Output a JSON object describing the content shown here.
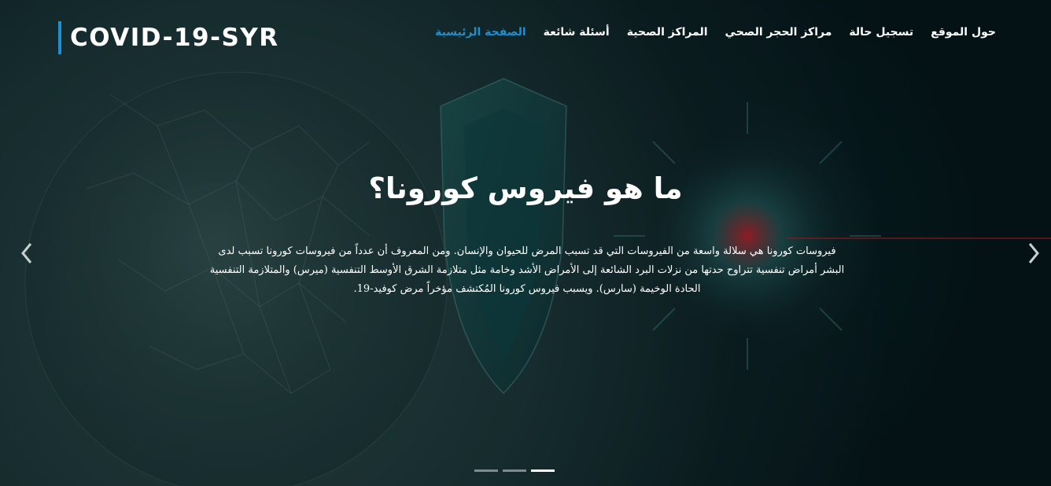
{
  "brand": {
    "name": "COVID-19-SYR",
    "accent": "#1e8fd0"
  },
  "nav": {
    "items": [
      {
        "label": "الصفحة الرئيسية",
        "active": true
      },
      {
        "label": "أسئلة شائعة",
        "active": false
      },
      {
        "label": "المراكز الصحية",
        "active": false
      },
      {
        "label": "مراكز الحجر الصحي",
        "active": false
      },
      {
        "label": "تسجيل حالة",
        "active": false
      },
      {
        "label": "حول الموقع",
        "active": false
      }
    ]
  },
  "slide": {
    "title": "ما هو فيروس كورونا؟",
    "description": "فيروسات كورونا هي سلالة واسعة من الفيروسات التي قد تسبب المرض للحيوان والإنسان. ومن المعروف أن عدداً من فيروسات كورونا تسبب لدى البشر أمراض تنفسية تتراوح حدتها من نزلات البرد الشائعة إلى الأمراض الأشد وخامة مثل متلازمة الشرق الأوسط التنفسية (ميرس) والمتلازمة التنفسية الحادة الوخيمة (سارس). ويسبب فيروس كورونا المُكتشف مؤخراً مرض كوفيد-19."
  },
  "carousel": {
    "prev_icon": "chevron-left-icon",
    "next_icon": "chevron-right-icon",
    "indicators": [
      {
        "active": false
      },
      {
        "active": false
      },
      {
        "active": true
      }
    ]
  },
  "colors": {
    "background": "#061a1f",
    "text": "#ffffff",
    "accent": "#1e8fd0"
  }
}
